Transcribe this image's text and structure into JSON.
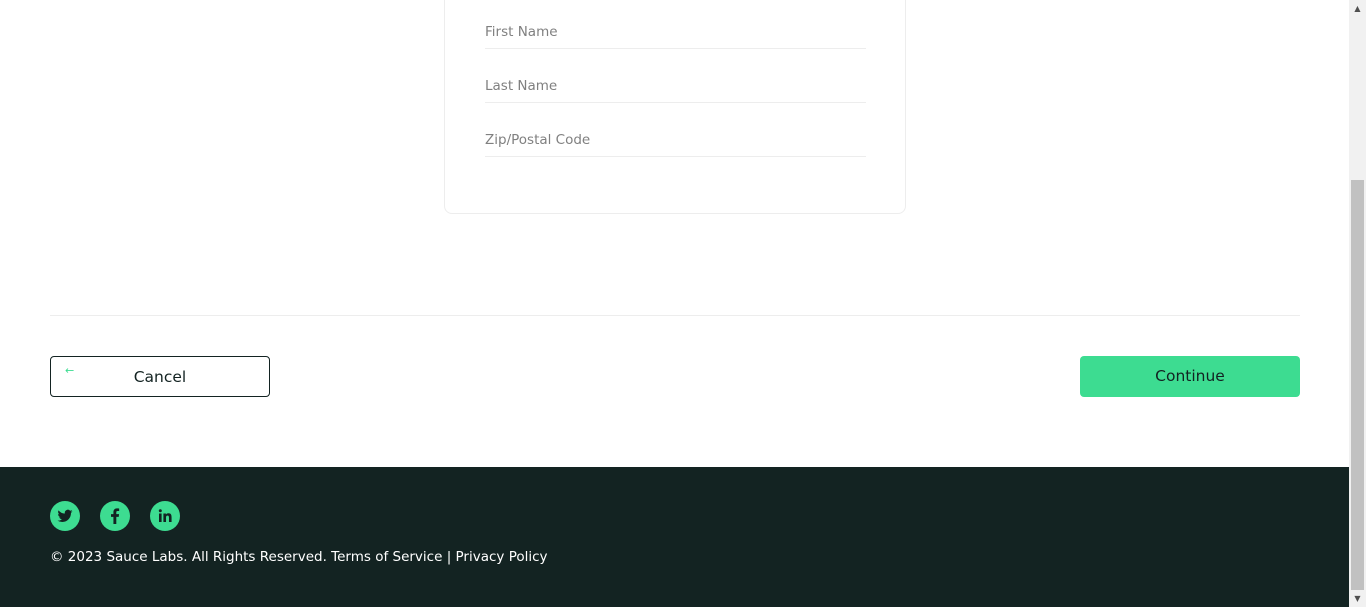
{
  "form": {
    "first_name_placeholder": "First Name",
    "last_name_placeholder": "Last Name",
    "zip_placeholder": "Zip/Postal Code"
  },
  "actions": {
    "cancel_label": "Cancel",
    "cancel_icon": "arrow-left-icon",
    "continue_label": "Continue"
  },
  "footer": {
    "social": [
      {
        "name": "twitter",
        "icon": "twitter-icon"
      },
      {
        "name": "facebook",
        "icon": "facebook-icon"
      },
      {
        "name": "linkedin",
        "icon": "linkedin-icon"
      }
    ],
    "copyright": "© 2023 Sauce Labs. All Rights Reserved. Terms of Service | Privacy Policy"
  },
  "colors": {
    "accent": "#3ddc91",
    "dark": "#132322",
    "border": "#ededed",
    "placeholder": "#808080"
  }
}
